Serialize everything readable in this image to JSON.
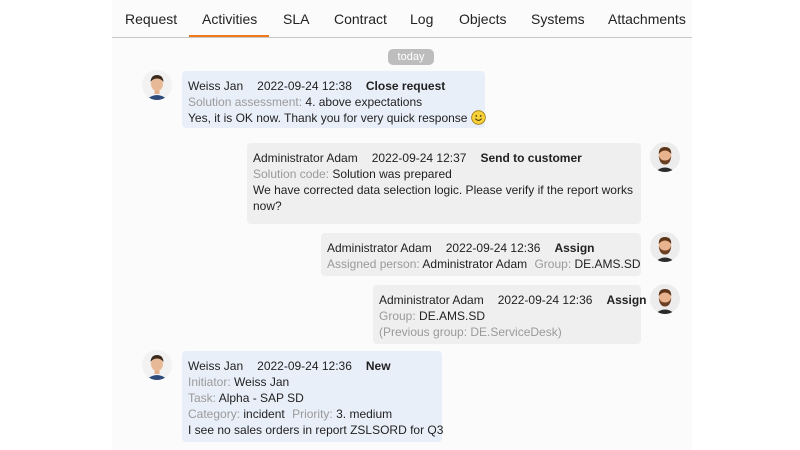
{
  "tabs": [
    {
      "label": "Request"
    },
    {
      "label": "Activities",
      "active": true
    },
    {
      "label": "SLA"
    },
    {
      "label": "Contract"
    },
    {
      "label": "Log"
    },
    {
      "label": "Objects"
    },
    {
      "label": "Systems"
    },
    {
      "label": "Attachments"
    }
  ],
  "accent_color": "#f07a1a",
  "day_separator": "today",
  "activities": [
    {
      "author": "Weiss Jan",
      "datetime": "2022-09-24 12:38",
      "action": "Close request",
      "avatar": "male-avatar-icon",
      "fields": [
        {
          "label": "Solution assessment:",
          "value": "4. above expectations"
        }
      ],
      "text": "Yes, it is OK now. Thank you for very quick response",
      "emoji": "smiley-icon"
    },
    {
      "author": "Administrator Adam",
      "datetime": "2022-09-24 12:37",
      "action": "Send to customer",
      "avatar": "bearded-avatar-icon",
      "fields": [
        {
          "label": "Solution code:",
          "value": "Solution was prepared"
        }
      ],
      "text_lines": [
        "We have corrected data selection logic. Please verify if the report works",
        "now?"
      ]
    },
    {
      "author": "Administrator Adam",
      "datetime": "2022-09-24 12:36",
      "action": "Assign",
      "avatar": "bearded-avatar-icon",
      "assigned_label": "Assigned person:",
      "assigned_value": "Administrator Adam",
      "group_label": "Group:",
      "group_value": "DE.AMS.SD"
    },
    {
      "author": "Administrator Adam",
      "datetime": "2022-09-24 12:36",
      "action": "Assign",
      "avatar": "bearded-avatar-icon",
      "group_label": "Group:",
      "group_value": "DE.AMS.SD",
      "previous_group": "(Previous group: DE.ServiceDesk)"
    },
    {
      "author": "Weiss Jan",
      "datetime": "2022-09-24 12:36",
      "action": "New",
      "avatar": "male-avatar-icon",
      "initiator_label": "Initiator:",
      "initiator_value": "Weiss Jan",
      "task_label": "Task:",
      "task_value": "Alpha - SAP SD",
      "category_label": "Category:",
      "category_value": "incident",
      "priority_label": "Priority:",
      "priority_value": "3. medium",
      "text": "I see no sales orders in report ZSLSORD for Q3"
    }
  ]
}
